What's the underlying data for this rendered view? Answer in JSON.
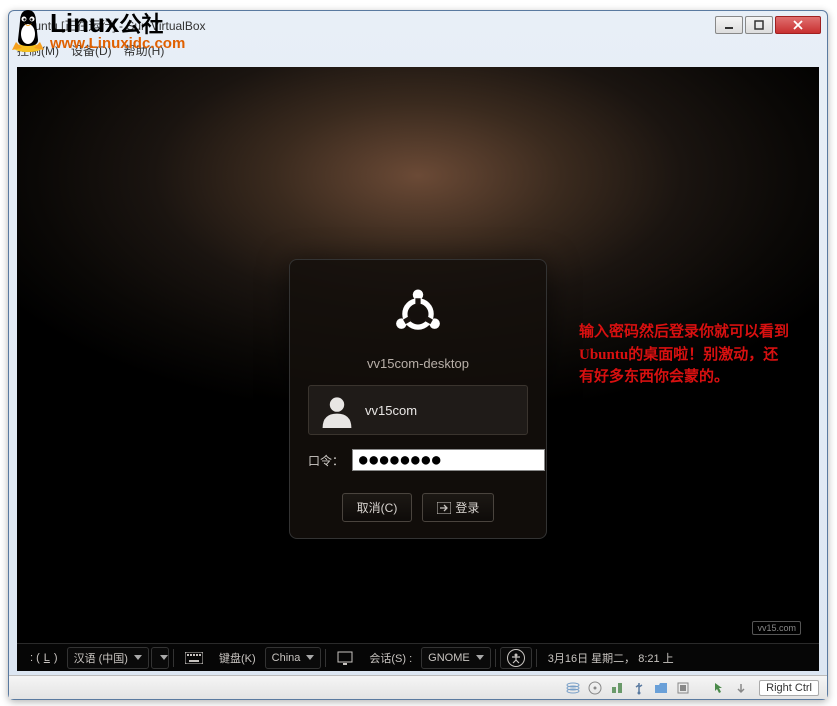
{
  "window": {
    "title": "Ubuntu [正在运行] - Sun VirtualBox"
  },
  "menubar": {
    "items": [
      "控制(M)",
      "设备(D)",
      "帮助(H)"
    ]
  },
  "login": {
    "hostname": "vv15com-desktop",
    "username": "vv15com",
    "password_label": "口令：",
    "password_value": "●●●●●●●●",
    "cancel_label": "取消(C)",
    "login_label": "登录"
  },
  "annotation": "输入密码然后登录你就可以看到Ubuntu的桌面啦！别激动，还有好多东西你会蒙的。",
  "panel": {
    "lang_key": "L",
    "lang_label": "汉语 (中国)",
    "keyboard_label": "键盘(K)",
    "keyboard_value": "China",
    "session_label": "会话(S) :",
    "session_value": "GNOME",
    "clock": "3月16日 星期二， 8:21 上"
  },
  "hostbar": {
    "hostkey": "Right Ctrl"
  },
  "watermark": {
    "line1_a": "Linux",
    "line1_b": "公社",
    "line2": "www.Linuxidc.com",
    "corner": "vv15.com"
  }
}
